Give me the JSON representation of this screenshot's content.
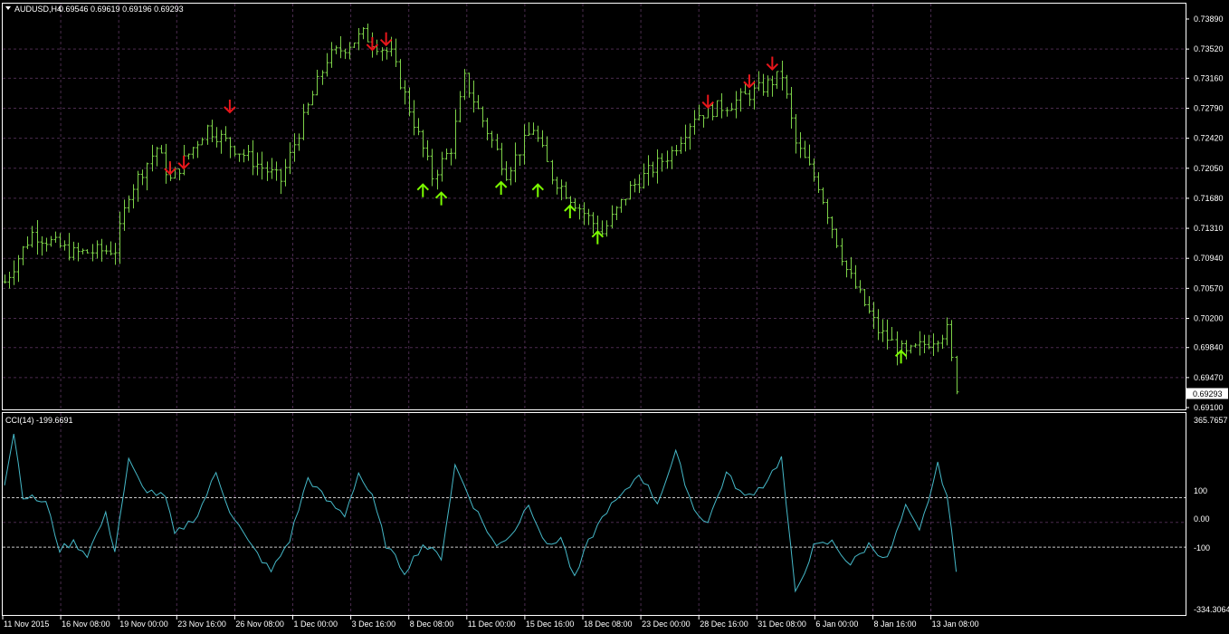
{
  "colors": {
    "background": "#000000",
    "frame": "#ffffff",
    "grid": "#4a2b4e",
    "bars": "#7cd148",
    "cci": "#45b8c8",
    "down_arrow": "#e8161b",
    "up_arrow": "#7cfc00",
    "level_line": "#c8c8c8",
    "text": "#ffffff"
  },
  "header": {
    "menu_icon": "triangle-down-icon",
    "symbol": "AUDUSD,H4",
    "ohlc": "0.69546 0.69619 0.69196 0.69293"
  },
  "price_axis": {
    "ticks": [
      "0.73890",
      "0.73520",
      "0.73160",
      "0.72790",
      "0.72420",
      "0.72050",
      "0.71680",
      "0.71310",
      "0.70940",
      "0.70570",
      "0.70200",
      "0.69840",
      "0.69470",
      "0.69100"
    ],
    "current": "0.69293"
  },
  "indicator": {
    "label": "CCI(14) -199.6691",
    "ticks": {
      "top": "365.7657",
      "p100": "100",
      "zero": "0.00",
      "m100": "-100",
      "bottom": "-334.3064"
    }
  },
  "time_axis": {
    "labels": [
      "11 Nov 2015",
      "16 Nov 08:00",
      "19 Nov 00:00",
      "23 Nov 16:00",
      "26 Nov 08:00",
      "1 Dec 00:00",
      "3 Dec 16:00",
      "8 Dec 08:00",
      "11 Dec 00:00",
      "15 Dec 16:00",
      "18 Dec 08:00",
      "23 Dec 00:00",
      "28 Dec 16:00",
      "31 Dec 08:00",
      "6 Jan 00:00",
      "8 Jan 16:00",
      "13 Jan 08:00"
    ]
  },
  "chart_data": [
    {
      "type": "ohlc",
      "symbol": "AUDUSD",
      "timeframe": "H4",
      "ylim": [
        0.691,
        0.7389
      ],
      "grid": true,
      "bar_count": 208,
      "last_close": 0.69293,
      "close_path": [
        {
          "bar": 0,
          "close": 0.7065
        },
        {
          "bar": 6,
          "close": 0.7125
        },
        {
          "bar": 15,
          "close": 0.71
        },
        {
          "bar": 24,
          "close": 0.7105
        },
        {
          "bar": 27,
          "close": 0.7175
        },
        {
          "bar": 33,
          "close": 0.723
        },
        {
          "bar": 36,
          "close": 0.719
        },
        {
          "bar": 44,
          "close": 0.7255
        },
        {
          "bar": 50,
          "close": 0.723
        },
        {
          "bar": 60,
          "close": 0.719
        },
        {
          "bar": 70,
          "close": 0.734
        },
        {
          "bar": 78,
          "close": 0.737
        },
        {
          "bar": 84,
          "close": 0.7345
        },
        {
          "bar": 93,
          "close": 0.7195
        },
        {
          "bar": 97,
          "close": 0.723
        },
        {
          "bar": 100,
          "close": 0.7315
        },
        {
          "bar": 109,
          "close": 0.72
        },
        {
          "bar": 115,
          "close": 0.7255
        },
        {
          "bar": 119,
          "close": 0.7195
        },
        {
          "bar": 126,
          "close": 0.715
        },
        {
          "bar": 130,
          "close": 0.7125
        },
        {
          "bar": 136,
          "close": 0.718
        },
        {
          "bar": 145,
          "close": 0.7225
        },
        {
          "bar": 150,
          "close": 0.727
        },
        {
          "bar": 158,
          "close": 0.7285
        },
        {
          "bar": 165,
          "close": 0.7305
        },
        {
          "bar": 169,
          "close": 0.732
        },
        {
          "bar": 172,
          "close": 0.7235
        },
        {
          "bar": 177,
          "close": 0.7185
        },
        {
          "bar": 183,
          "close": 0.708
        },
        {
          "bar": 190,
          "close": 0.7005
        },
        {
          "bar": 196,
          "close": 0.6975
        },
        {
          "bar": 202,
          "close": 0.6995
        },
        {
          "bar": 205,
          "close": 0.7005
        },
        {
          "bar": 207,
          "close": 0.69293
        }
      ],
      "signals": [
        {
          "direction": "down",
          "bar": 36,
          "price": 0.7198
        },
        {
          "direction": "down",
          "bar": 39,
          "price": 0.7205
        },
        {
          "direction": "down",
          "bar": 49,
          "price": 0.7274
        },
        {
          "direction": "down",
          "bar": 80,
          "price": 0.7351
        },
        {
          "direction": "down",
          "bar": 83,
          "price": 0.7357
        },
        {
          "direction": "up",
          "bar": 91,
          "price": 0.7185
        },
        {
          "direction": "up",
          "bar": 95,
          "price": 0.7175
        },
        {
          "direction": "up",
          "bar": 108,
          "price": 0.7188
        },
        {
          "direction": "up",
          "bar": 116,
          "price": 0.7185
        },
        {
          "direction": "up",
          "bar": 123,
          "price": 0.7159
        },
        {
          "direction": "up",
          "bar": 129,
          "price": 0.7127
        },
        {
          "direction": "down",
          "bar": 153,
          "price": 0.728
        },
        {
          "direction": "down",
          "bar": 162,
          "price": 0.7305
        },
        {
          "direction": "down",
          "bar": 167,
          "price": 0.7327
        },
        {
          "direction": "up",
          "bar": 195,
          "price": 0.698
        }
      ]
    },
    {
      "type": "line",
      "title": "CCI(14)",
      "ylim": [
        -334.3064,
        365.7657
      ],
      "levels": [
        100,
        -100
      ],
      "last_value": -199.6691,
      "points": [
        {
          "bar": 0,
          "value": 150
        },
        {
          "bar": 2,
          "value": 365
        },
        {
          "bar": 4,
          "value": 110
        },
        {
          "bar": 9,
          "value": 80
        },
        {
          "bar": 12,
          "value": -110
        },
        {
          "bar": 15,
          "value": -80
        },
        {
          "bar": 18,
          "value": -130
        },
        {
          "bar": 22,
          "value": 30
        },
        {
          "bar": 24,
          "value": -110
        },
        {
          "bar": 27,
          "value": 250
        },
        {
          "bar": 30,
          "value": 140
        },
        {
          "bar": 35,
          "value": 100
        },
        {
          "bar": 37,
          "value": -50
        },
        {
          "bar": 42,
          "value": 30
        },
        {
          "bar": 46,
          "value": 200
        },
        {
          "bar": 49,
          "value": 50
        },
        {
          "bar": 53,
          "value": -80
        },
        {
          "bar": 58,
          "value": -200
        },
        {
          "bar": 62,
          "value": -70
        },
        {
          "bar": 66,
          "value": 180
        },
        {
          "bar": 70,
          "value": 90
        },
        {
          "bar": 74,
          "value": 30
        },
        {
          "bar": 77,
          "value": 200
        },
        {
          "bar": 80,
          "value": 100
        },
        {
          "bar": 83,
          "value": -90
        },
        {
          "bar": 87,
          "value": -200
        },
        {
          "bar": 91,
          "value": -90
        },
        {
          "bar": 95,
          "value": -140
        },
        {
          "bar": 98,
          "value": 230
        },
        {
          "bar": 102,
          "value": 70
        },
        {
          "bar": 107,
          "value": -100
        },
        {
          "bar": 111,
          "value": -30
        },
        {
          "bar": 114,
          "value": 80
        },
        {
          "bar": 118,
          "value": -100
        },
        {
          "bar": 121,
          "value": -60
        },
        {
          "bar": 124,
          "value": -230
        },
        {
          "bar": 127,
          "value": -80
        },
        {
          "bar": 131,
          "value": 50
        },
        {
          "bar": 135,
          "value": 120
        },
        {
          "bar": 138,
          "value": 200
        },
        {
          "bar": 142,
          "value": 80
        },
        {
          "bar": 146,
          "value": 280
        },
        {
          "bar": 150,
          "value": 50
        },
        {
          "bar": 153,
          "value": 0
        },
        {
          "bar": 157,
          "value": 200
        },
        {
          "bar": 161,
          "value": 100
        },
        {
          "bar": 165,
          "value": 150
        },
        {
          "bar": 169,
          "value": 260
        },
        {
          "bar": 172,
          "value": -290
        },
        {
          "bar": 176,
          "value": -100
        },
        {
          "bar": 180,
          "value": -80
        },
        {
          "bar": 184,
          "value": -170
        },
        {
          "bar": 188,
          "value": -90
        },
        {
          "bar": 192,
          "value": -150
        },
        {
          "bar": 196,
          "value": 60
        },
        {
          "bar": 199,
          "value": -40
        },
        {
          "bar": 203,
          "value": 230
        },
        {
          "bar": 205,
          "value": 110
        },
        {
          "bar": 207,
          "value": -199.6691
        }
      ]
    }
  ]
}
